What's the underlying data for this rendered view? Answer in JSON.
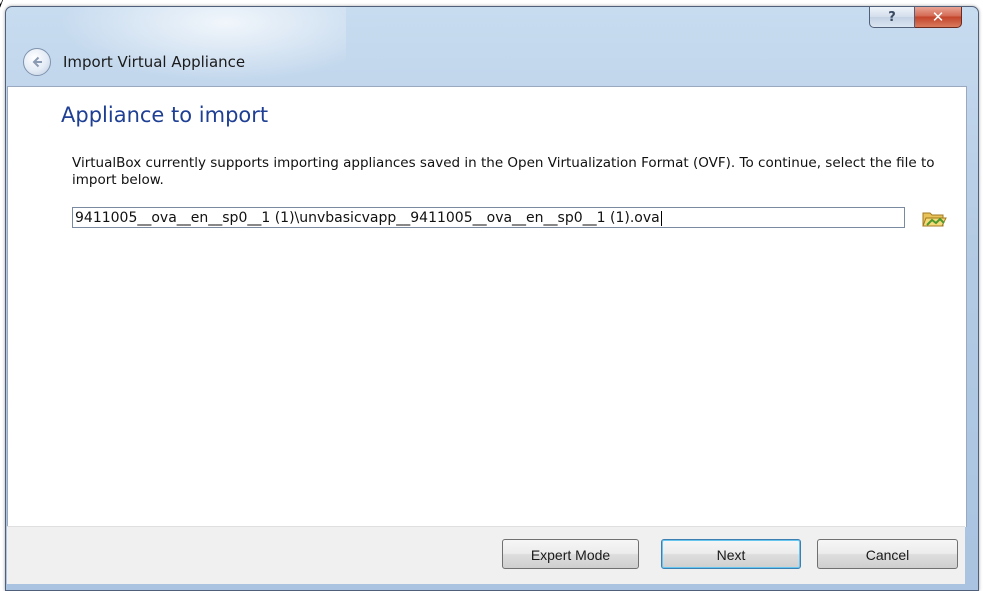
{
  "background": {
    "text": "y"
  },
  "window": {
    "help_glyph": "?",
    "close_glyph": "✕"
  },
  "wizard": {
    "title": "Import Virtual Appliance",
    "page_title": "Appliance to import",
    "description": "VirtualBox currently supports importing appliances saved in the Open Virtualization Format (OVF). To continue, select the file to import below.",
    "file_path": "9411005__ova__en__sp0__1 (1)\\unvbasicvapp__9411005__ova__en__sp0__1 (1).ova"
  },
  "buttons": {
    "expert_mode": "Expert Mode",
    "next": "Next",
    "cancel": "Cancel"
  },
  "icons": {
    "back": "back-arrow-icon",
    "open_file": "folder-open-icon"
  },
  "colors": {
    "page_title": "#1e3f93",
    "close_button": "#c2432a",
    "default_button_border": "#3c7fb1"
  }
}
